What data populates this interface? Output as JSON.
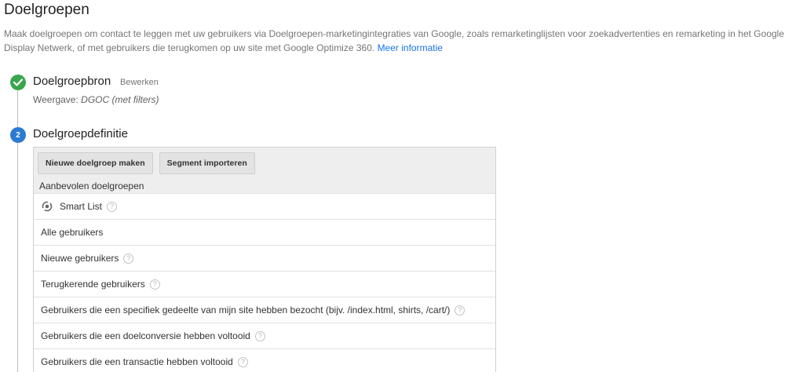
{
  "header": {
    "title": "Doelgroepen",
    "description": "Maak doelgroepen om contact te leggen met uw gebruikers via Doelgroepen-marketingintegraties van Google, zoals remarketinglijsten voor zoekadvertenties en remarketing in het Google Display Netwerk, of met gebruikers die terugkomen op uw site met Google Optimize 360.",
    "more_info_link": "Meer informatie"
  },
  "steps": {
    "step1": {
      "title": "Doelgroepbron",
      "edit_label": "Bewerken",
      "view_prefix": "Weergave:",
      "view_value": "DGOC (met filters)",
      "status_color": "#3aa64f"
    },
    "step2": {
      "number": "2",
      "title": "Doelgroepdefinitie",
      "badge_color": "#2d7bd1"
    }
  },
  "panel": {
    "buttons": {
      "new_audience": "Nieuwe doelgroep maken",
      "import_segment": "Segment importeren"
    },
    "recommended_header": "Aanbevolen doelgroepen",
    "items": [
      {
        "label": "Smart List",
        "help": "?",
        "icon": "smart-list-icon"
      },
      {
        "label": "Alle gebruikers"
      },
      {
        "label": "Nieuwe gebruikers",
        "help": "?"
      },
      {
        "label": "Terugkerende gebruikers",
        "help": "?"
      },
      {
        "label": "Gebruikers die een specifiek gedeelte van mijn site hebben bezocht (bijv. /index.html, shirts, /cart/)",
        "help": "?"
      },
      {
        "label": "Gebruikers die een doelconversie hebben voltooid",
        "help": "?"
      },
      {
        "label": "Gebruikers die een transactie hebben voltooid",
        "help": "?"
      }
    ]
  }
}
